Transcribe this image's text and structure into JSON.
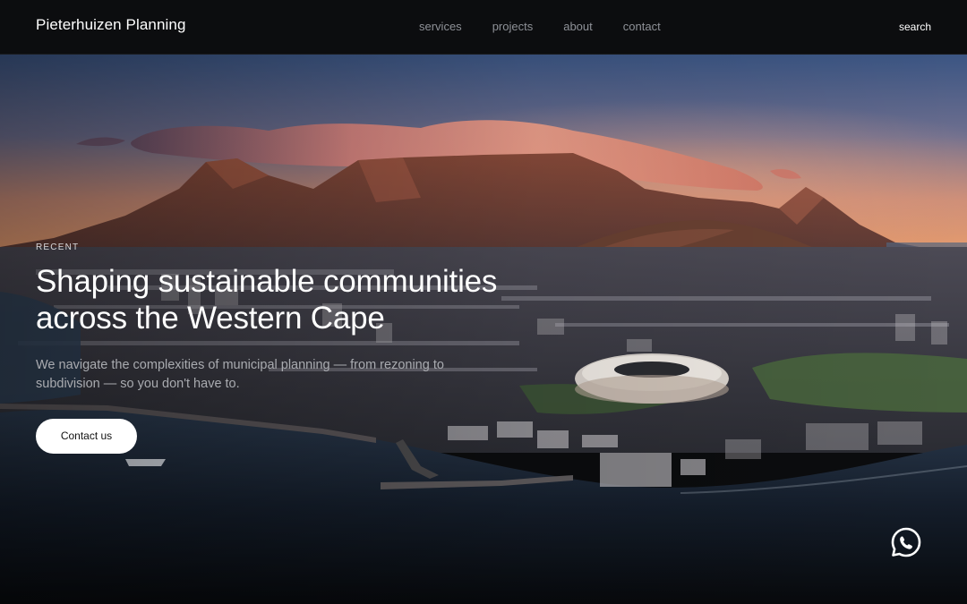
{
  "header": {
    "brand": "Pieterhuizen Planning",
    "nav": [
      {
        "label": "services"
      },
      {
        "label": "projects"
      },
      {
        "label": "about"
      },
      {
        "label": "contact"
      }
    ],
    "search_label": "search"
  },
  "hero": {
    "eyebrow": "RECENT",
    "headline_line1": "Shaping sustainable communities",
    "headline_line2": "across the Western Cape",
    "subcopy": "We navigate the complexities of municipal planning — from rezoning to subdivision — so you don't have to.",
    "cta_label": "Contact us"
  },
  "floating": {
    "whatsapp_icon": "whatsapp-icon"
  },
  "colors": {
    "header_bg": "#0c0d0f",
    "nav_text": "#8e9197",
    "cta_bg": "#ffffff"
  }
}
